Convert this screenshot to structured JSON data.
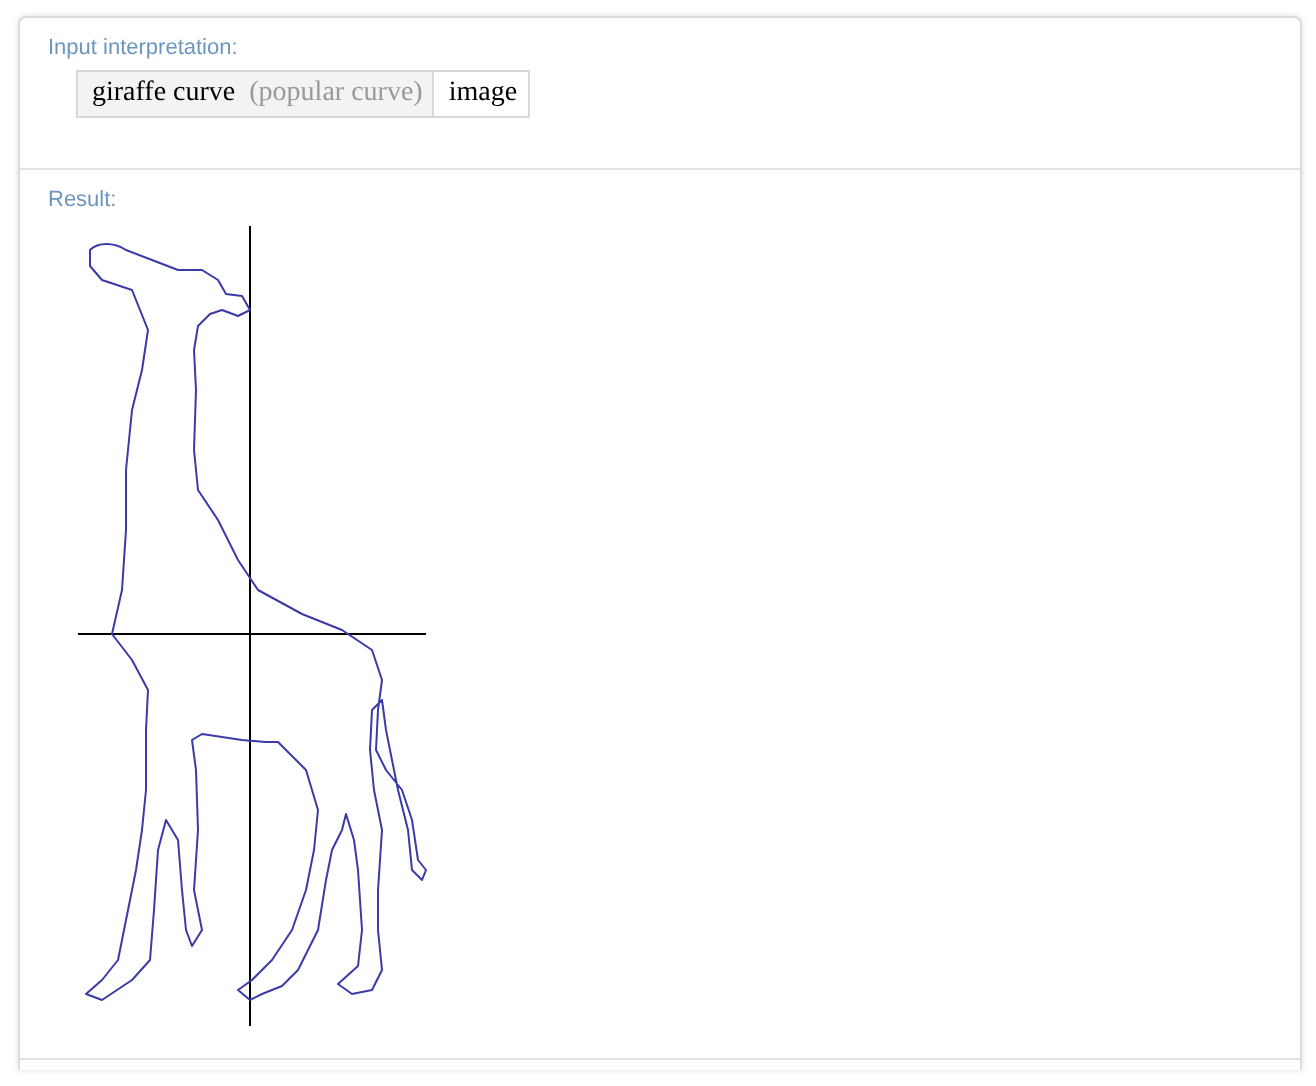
{
  "pods": [
    {
      "title": "Input interpretation:",
      "kind": "interpretation",
      "cells": [
        {
          "text": "giraffe curve",
          "note": "(popular curve)"
        },
        {
          "text": "image"
        }
      ]
    },
    {
      "title": "Result:",
      "kind": "plot"
    }
  ]
}
